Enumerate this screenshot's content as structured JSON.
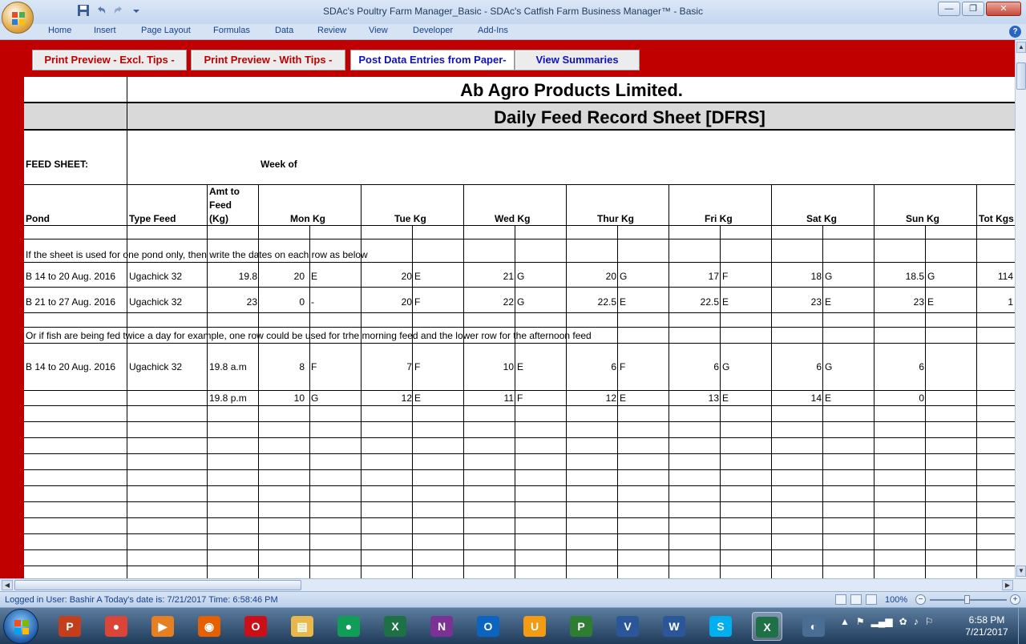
{
  "window": {
    "title": "SDAc's Poultry Farm Manager_Basic  -  SDAc's Catfish Farm Business Manager™ - Basic",
    "minimize": "—",
    "restore": "❐",
    "close": "✕"
  },
  "ribbon": {
    "tabs": [
      "Home",
      "Insert",
      "Page Layout",
      "Formulas",
      "Data",
      "Review",
      "View",
      "Developer",
      "Add-Ins"
    ],
    "help": "?"
  },
  "toolbar": {
    "print_excl": "Print Preview - Excl. Tips -",
    "print_with": "Print Preview - With Tips -",
    "post_data": "Post Data Entries from Paper-",
    "view_summaries": "View Summaries"
  },
  "sheet": {
    "company": "Ab   Agro Products Limited.",
    "title": "Daily Feed Record Sheet [DFRS]",
    "feed_sheet_label": "FEED SHEET:",
    "week_of_label": "Week of",
    "headers": {
      "pond": "Pond",
      "type_feed": "Type Feed",
      "amt_line1": "Amt to",
      "amt_line2": "Feed",
      "amt_line3": "(Kg)",
      "mon": "Mon Kg",
      "tue": "Tue Kg",
      "wed": "Wed Kg",
      "thur": "Thur Kg",
      "fri": "Fri Kg",
      "sat": "Sat Kg",
      "sun": "Sun Kg",
      "tot": "Tot Kgs"
    },
    "note1": "If the sheet is used for one pond only, then write the dates on each row as below",
    "note2": "Or if fish are being fed twice a day for example, one row could be used for trhe morning feed and the lower row for the afternoon feed",
    "rows": [
      {
        "pond": "B 14 to 20 Aug. 2016",
        "feed": "Ugachick 32",
        "amt": "19.8",
        "vals": [
          "20",
          "E",
          "20",
          "E",
          "21",
          "G",
          "20",
          "G",
          "17",
          "F",
          "18",
          "G",
          "18.5",
          "G"
        ],
        "tot": "114"
      },
      {
        "pond": "B 21 to 27 Aug. 2016",
        "feed": "Ugachick 32",
        "amt": "23",
        "vals": [
          "0",
          "-",
          "20",
          "F",
          "22",
          "G",
          "22.5",
          "E",
          "22.5",
          "E",
          "23",
          "E",
          "23",
          "E"
        ],
        "tot": "1"
      },
      {
        "pond": "B 14 to 20 Aug. 2016",
        "feed": "Ugachick 32",
        "amt": "19.8 a.m",
        "vals": [
          "8",
          "F",
          "7",
          "F",
          "10",
          "E",
          "6",
          "F",
          "6",
          "G",
          "6",
          "G",
          "6",
          ""
        ],
        "tot": ""
      },
      {
        "pond": "",
        "feed": "",
        "amt": "19.8 p.m",
        "vals": [
          "10",
          "G",
          "12",
          "E",
          "11",
          "F",
          "12",
          "E",
          "13",
          "E",
          "14",
          "E",
          "0",
          ""
        ],
        "tot": ""
      }
    ]
  },
  "status": {
    "text": "Logged in User: Bashir A       Today's date is: 7/21/2017 Time: 6:58:46 PM",
    "zoom": "100%",
    "zoom_minus": "−",
    "zoom_plus": "+"
  },
  "taskbar": {
    "icons": [
      {
        "name": "powerpoint-icon",
        "label": "P",
        "color": "#c43e1c"
      },
      {
        "name": "chrome-icon",
        "label": "●",
        "color": "#db4437"
      },
      {
        "name": "media-player-icon",
        "label": "▶",
        "color": "#e67e22"
      },
      {
        "name": "firefox-icon",
        "label": "◉",
        "color": "#e66000"
      },
      {
        "name": "opera-icon",
        "label": "O",
        "color": "#cc0f16"
      },
      {
        "name": "file-explorer-icon",
        "label": "▤",
        "color": "#e8b84a"
      },
      {
        "name": "chrome-icon-2",
        "label": "●",
        "color": "#0f9d58"
      },
      {
        "name": "excel-icon",
        "label": "X",
        "color": "#1d7145"
      },
      {
        "name": "onenote-icon",
        "label": "N",
        "color": "#7b3294"
      },
      {
        "name": "outlook-icon",
        "label": "O",
        "color": "#0b64c0"
      },
      {
        "name": "uc-browser-icon",
        "label": "U",
        "color": "#f39c12"
      },
      {
        "name": "project-icon",
        "label": "P",
        "color": "#2f7d32"
      },
      {
        "name": "visio-icon",
        "label": "V",
        "color": "#2b579a"
      },
      {
        "name": "word-icon",
        "label": "W",
        "color": "#2b579a"
      },
      {
        "name": "skype-icon",
        "label": "S",
        "color": "#00aff0"
      },
      {
        "name": "excel-active-icon",
        "label": "X",
        "color": "#1d7145"
      },
      {
        "name": "unknown-app-icon",
        "label": "◐",
        "color": "#4a6d93"
      }
    ],
    "tray": [
      "▲",
      "⚑",
      "▂▄▆",
      "✿",
      "♪",
      "⚐"
    ],
    "time": "6:58 PM",
    "date": "7/21/2017"
  }
}
